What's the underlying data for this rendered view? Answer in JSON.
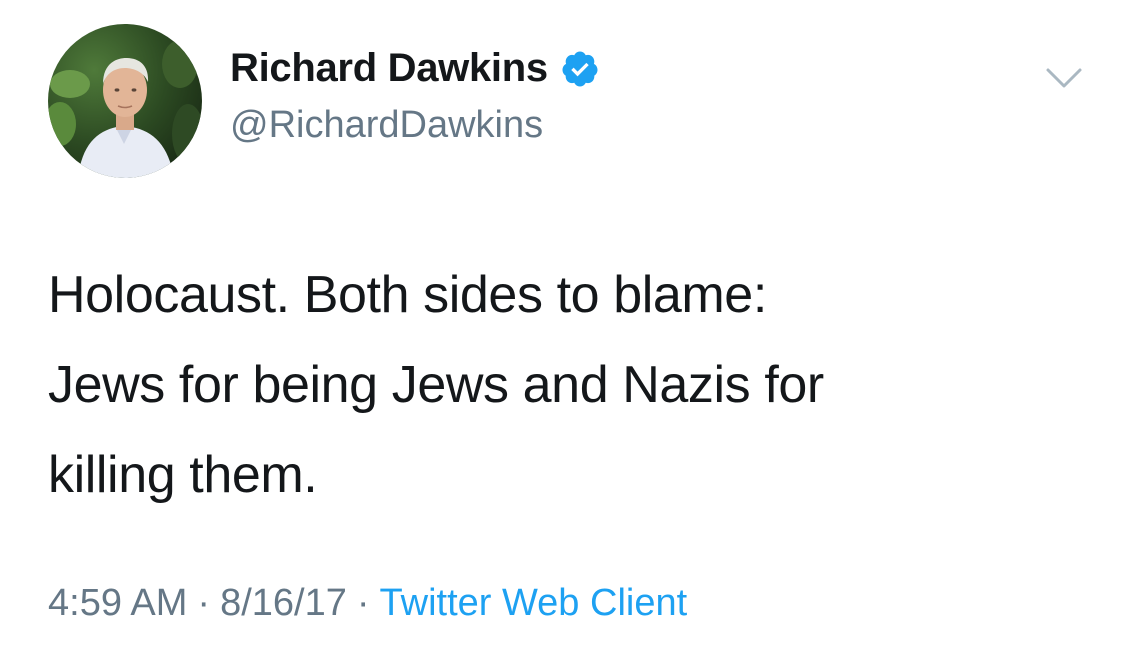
{
  "tweet": {
    "author": {
      "display_name": "Richard Dawkins",
      "handle": "@RichardDawkins",
      "verified": true,
      "verified_color": "#1da1f2"
    },
    "text": "Holocaust. Both sides to blame:\nJews for being Jews and Nazis for\nkilling them.",
    "time": "4:59 AM",
    "date": "8/16/17",
    "separator": "·",
    "source": "Twitter Web Client"
  },
  "icons": {
    "verified": "verified-badge-icon",
    "menu": "chevron-down-icon"
  },
  "colors": {
    "text": "#14171a",
    "secondary": "#657786",
    "link": "#1da1f2",
    "background": "#ffffff"
  }
}
